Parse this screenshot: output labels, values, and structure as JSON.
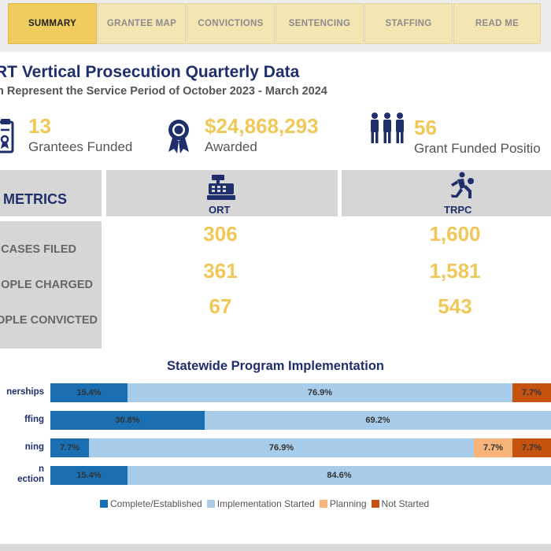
{
  "tabs": [
    {
      "label": "SUMMARY",
      "active": true
    },
    {
      "label": "GRANTEE MAP",
      "active": false
    },
    {
      "label": "CONVICTIONS",
      "active": false
    },
    {
      "label": "SENTENCING",
      "active": false
    },
    {
      "label": "STAFFING",
      "active": false
    },
    {
      "label": "READ ME",
      "active": false
    }
  ],
  "page": {
    "title": "RT Vertical Prosecution Quarterly Data",
    "subtitle": "n Represent the Service Period of October 2023 - March 2024"
  },
  "stats": [
    {
      "value": "13",
      "label": "Grantees Funded",
      "icon": "clipboard-icon"
    },
    {
      "value": "$24,868,293",
      "label": "Awarded",
      "icon": "award-ribbon-icon"
    },
    {
      "value": "56",
      "label": "Grant Funded Positio",
      "icon": "people-group-icon"
    }
  ],
  "metrics": {
    "header": "METRICS",
    "columns": [
      {
        "label": "ORT",
        "icon": "cash-register-icon"
      },
      {
        "label": "TRPC",
        "icon": "running-thief-icon"
      }
    ],
    "rows": [
      {
        "label": "CASES FILED",
        "values": [
          "306",
          "1,600"
        ]
      },
      {
        "label": "OPLE CHARGED",
        "values": [
          "361",
          "1,581"
        ]
      },
      {
        "label": "OPLE CONVICTED",
        "values": [
          "67",
          "543"
        ]
      }
    ]
  },
  "chart_data": {
    "type": "bar",
    "stacked": true,
    "orientation": "horizontal",
    "title": "Statewide Program Implementation",
    "categories": [
      "nerships",
      "ffing",
      "ning",
      "n\nection"
    ],
    "series": [
      {
        "name": "Complete/Established",
        "color": "#1a6fb3",
        "values": [
          15.4,
          30.8,
          7.7,
          15.4
        ]
      },
      {
        "name": "Implementation Started",
        "color": "#a8cdea",
        "values": [
          76.9,
          69.2,
          76.9,
          84.6
        ]
      },
      {
        "name": "Planning",
        "color": "#f7b47a",
        "values": [
          0,
          0,
          7.7,
          0
        ]
      },
      {
        "name": "Not Started",
        "color": "#c5530f",
        "values": [
          7.7,
          0,
          7.7,
          0
        ]
      }
    ],
    "xlim": [
      0,
      100
    ],
    "legend": "bottom"
  }
}
